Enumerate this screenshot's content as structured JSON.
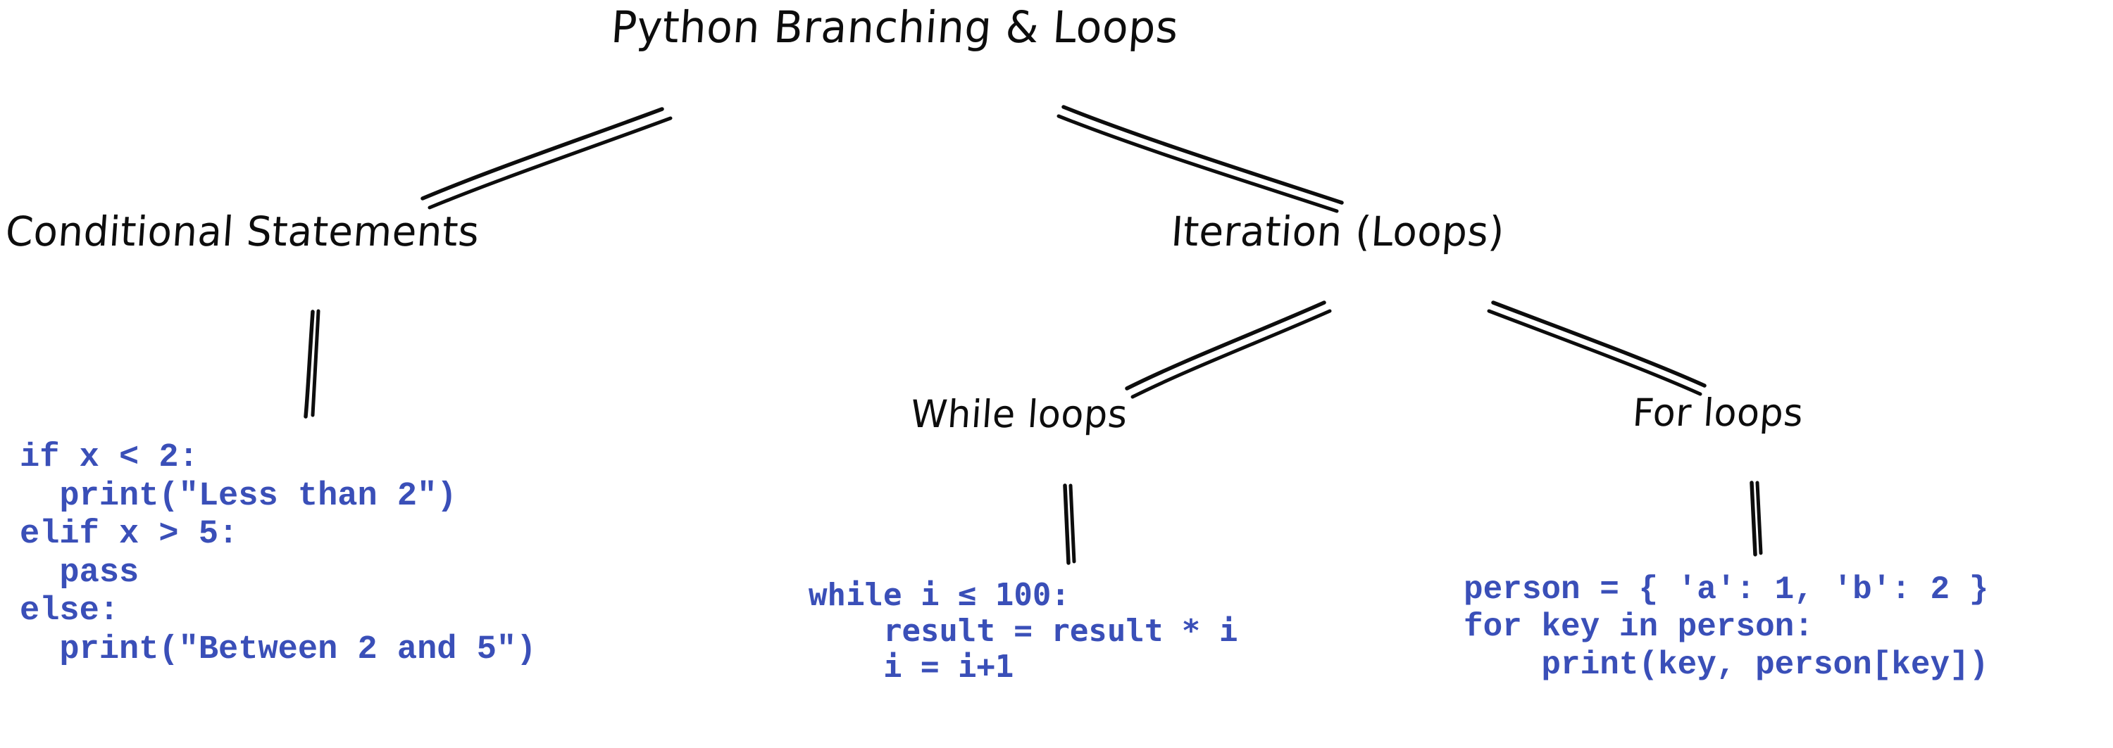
{
  "diagram": {
    "title": "Python Branching & Loops",
    "background_color": "#ffffff",
    "ink_color": "#0d0d0d",
    "code_color": "#3a4fb8",
    "nodes": {
      "root": "Python Branching & Loops",
      "conditional": "Conditional Statements",
      "iteration": "Iteration (Loops)",
      "while_loops": "While loops",
      "for_loops": "For loops"
    },
    "code": {
      "conditional": "if x < 2:\n  print(\"Less than 2\")\nelif x > 5:\n  pass\nelse:\n  print(\"Between 2 and 5\")",
      "while": "while i ≤ 100:\n    result = result * i\n    i = i+1",
      "for": "person = { 'a': 1, 'b': 2 }\nfor key in person:\n    print(key, person[key])"
    },
    "edges": [
      {
        "from": "root",
        "to": "conditional"
      },
      {
        "from": "root",
        "to": "iteration"
      },
      {
        "from": "conditional",
        "to": "conditional_code"
      },
      {
        "from": "iteration",
        "to": "while_loops"
      },
      {
        "from": "iteration",
        "to": "for_loops"
      },
      {
        "from": "while_loops",
        "to": "while_code"
      },
      {
        "from": "for_loops",
        "to": "for_code"
      }
    ]
  }
}
